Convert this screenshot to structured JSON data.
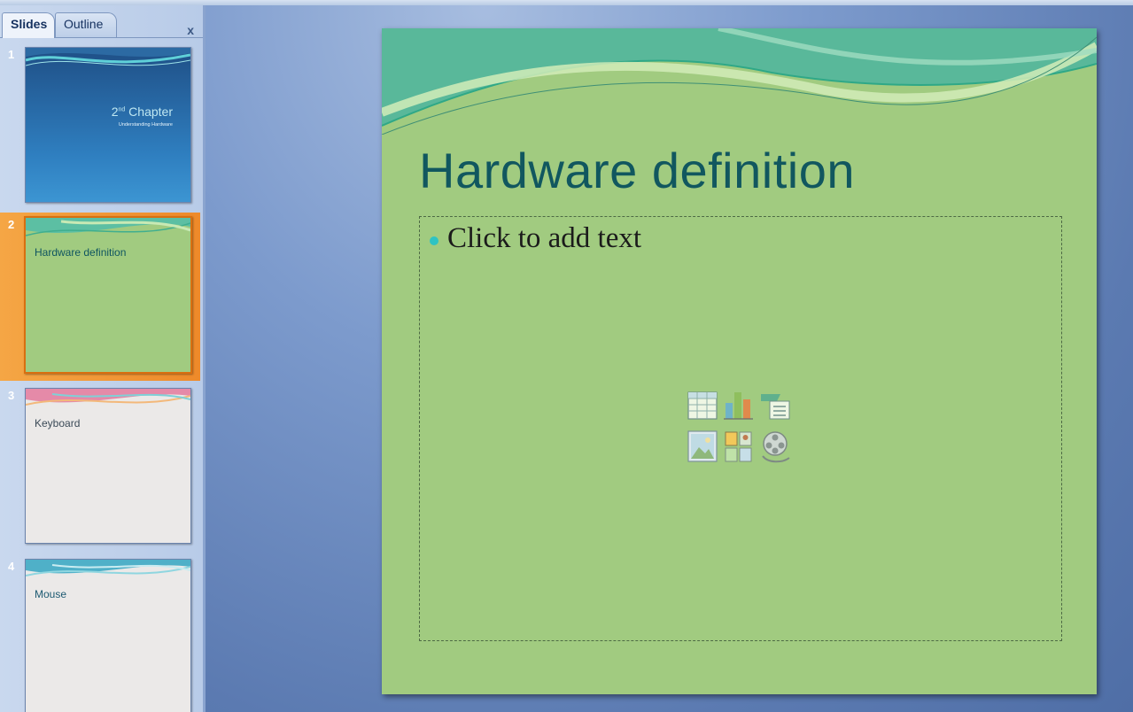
{
  "pane": {
    "tabs": [
      {
        "label": "Slides",
        "active": true
      },
      {
        "label": "Outline",
        "active": false
      }
    ],
    "close_label": "x",
    "thumbnails": [
      {
        "number": "1",
        "title_main": "2",
        "title_sup": "nd",
        "title_rest": " Chapter",
        "subtitle": "Understanding Hardware",
        "theme": "blue"
      },
      {
        "number": "2",
        "title": "Hardware definition",
        "theme": "green",
        "selected": true
      },
      {
        "number": "3",
        "title": "Keyboard",
        "theme": "pink"
      },
      {
        "number": "4",
        "title": "Mouse",
        "theme": "teal"
      }
    ]
  },
  "slide": {
    "title": "Hardware definition",
    "placeholder_text": "Click to add text",
    "content_icons": [
      "table-icon",
      "chart-icon",
      "smartart-icon",
      "picture-icon",
      "clipart-icon",
      "media-icon"
    ]
  },
  "colors": {
    "slide_bg": "#a1cb80",
    "title": "#11575f",
    "bullet": "#2fc3c3",
    "selection": "#ee8a2a"
  }
}
